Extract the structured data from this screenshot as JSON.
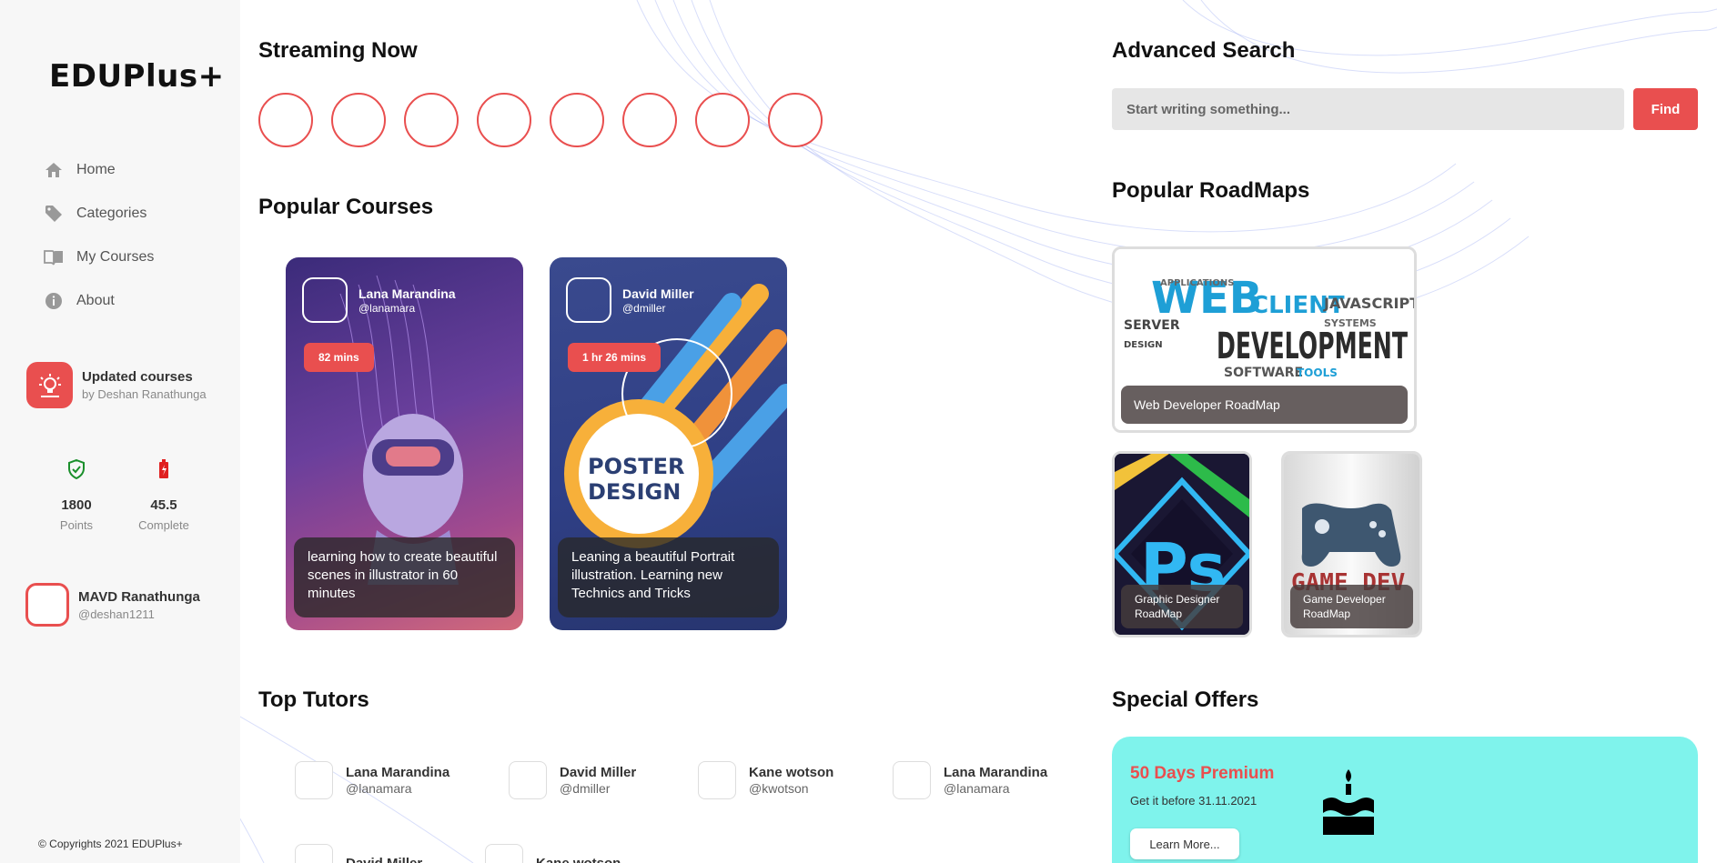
{
  "brand": "EDUPlus+",
  "nav": [
    {
      "label": "Home",
      "icon": "home-icon"
    },
    {
      "label": "Categories",
      "icon": "tag-icon"
    },
    {
      "label": "My Courses",
      "icon": "book-icon"
    },
    {
      "label": "About",
      "icon": "info-icon"
    }
  ],
  "update_card": {
    "title": "Updated courses",
    "subtitle": "by Deshan Ranathunga"
  },
  "stats": [
    {
      "value": "1800",
      "label": "Points",
      "icon": "shield-check-icon"
    },
    {
      "value": "45.5",
      "label": "Complete",
      "icon": "battery-icon"
    }
  ],
  "profile": {
    "name": "MAVD Ranathunga",
    "handle": "@deshan1211"
  },
  "copyright": "© Copyrights 2021 EDUPlus+",
  "streaming": {
    "title_bold": "Streaming",
    "title_rest": " Now",
    "count": 8
  },
  "popular_courses": {
    "title_bold": "Popular",
    "title_rest": " Courses",
    "items": [
      {
        "tutor_name": "Lana Marandina",
        "tutor_handle": "@lanamara",
        "duration": "82 mins",
        "description": "learning how to create beautiful scenes in illustrator in 60 minutes"
      },
      {
        "tutor_name": "David Miller",
        "tutor_handle": "@dmiller",
        "duration": "1 hr 26 mins",
        "description": "Leaning a beautiful Portrait illustration. Learning new Technics and Tricks"
      }
    ]
  },
  "top_tutors": {
    "title_bold": "Top",
    "title_rest": " Tutors",
    "items": [
      {
        "name": "Lana Marandina",
        "handle": "@lanamara"
      },
      {
        "name": "David Miller",
        "handle": "@dmiller"
      },
      {
        "name": "Kane wotson",
        "handle": "@kwotson"
      },
      {
        "name": "Lana Marandina",
        "handle": "@lanamara"
      },
      {
        "name": "David Miller",
        "handle": ""
      },
      {
        "name": "Kane wotson",
        "handle": ""
      }
    ]
  },
  "search": {
    "title_bold": "Advanced",
    "title_rest": " Search",
    "placeholder": "Start writing something...",
    "button": "Find"
  },
  "roadmaps": {
    "title_bold": "Popular",
    "title_rest": " RoadMaps",
    "items": [
      {
        "label": "Web Developer RoadMap"
      },
      {
        "label": "Graphic Designer RoadMap"
      },
      {
        "label": "Game Developer RoadMap"
      }
    ]
  },
  "offers": {
    "title_bold": "Special",
    "title_rest": " Offers",
    "headline": "50 Days Premium",
    "subtitle": "Get it before 31.11.2021",
    "button": "Learn More..."
  },
  "colors": {
    "accent": "#e94f4f",
    "offer_bg": "#7ff3ec"
  }
}
